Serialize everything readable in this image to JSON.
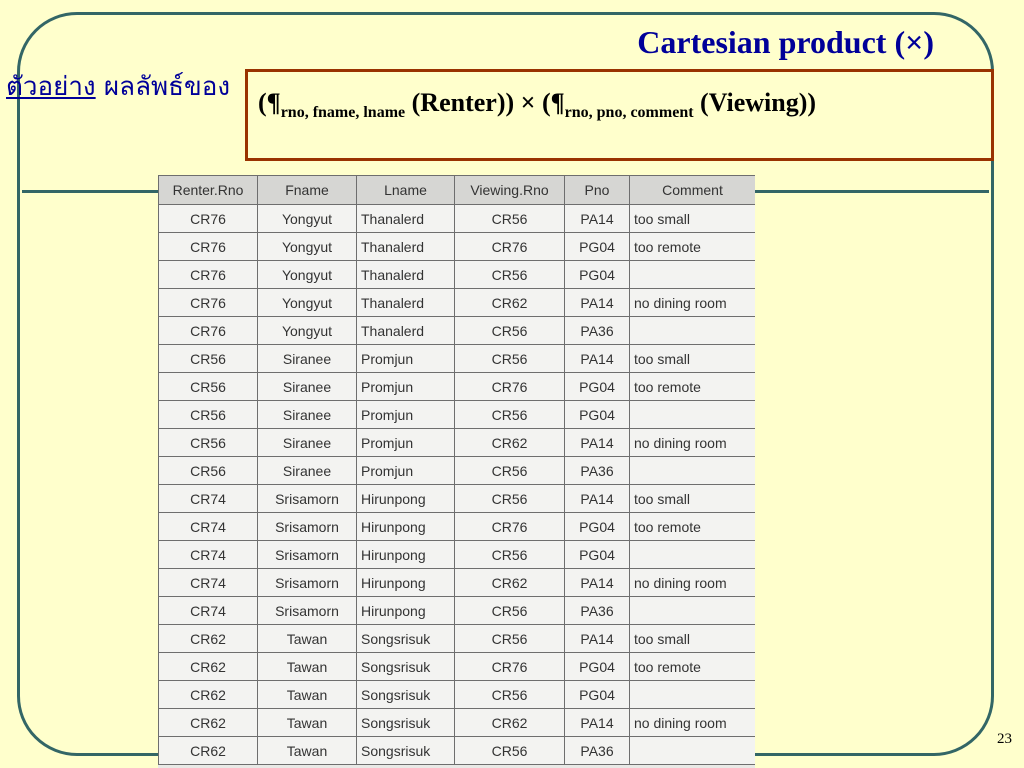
{
  "title": "Cartesian product (×)",
  "example": {
    "label": "ตัวอย่าง",
    "text": "ผลลัพธ์ของ"
  },
  "formula": {
    "open1": "(¶",
    "sub1": "rno, fname, lname",
    "rel1": " (Renter)) × (¶",
    "sub2": "rno, pno, comment",
    "rel2": " (Viewing))"
  },
  "table": {
    "headers": [
      "Renter.Rno",
      "Fname",
      "Lname",
      "Viewing.Rno",
      "Pno",
      "Comment"
    ],
    "rows": [
      [
        "CR76",
        "Yongyut",
        "Thanalerd",
        "CR56",
        "PA14",
        "too small"
      ],
      [
        "CR76",
        "Yongyut",
        "Thanalerd",
        "CR76",
        "PG04",
        "too remote"
      ],
      [
        "CR76",
        "Yongyut",
        "Thanalerd",
        "CR56",
        "PG04",
        ""
      ],
      [
        "CR76",
        "Yongyut",
        "Thanalerd",
        "CR62",
        "PA14",
        "no dining room"
      ],
      [
        "CR76",
        "Yongyut",
        "Thanalerd",
        "CR56",
        "PA36",
        ""
      ],
      [
        "CR56",
        "Siranee",
        "Promjun",
        "CR56",
        "PA14",
        "too small"
      ],
      [
        "CR56",
        "Siranee",
        "Promjun",
        "CR76",
        "PG04",
        "too remote"
      ],
      [
        "CR56",
        "Siranee",
        "Promjun",
        "CR56",
        "PG04",
        ""
      ],
      [
        "CR56",
        "Siranee",
        "Promjun",
        "CR62",
        "PA14",
        "no dining room"
      ],
      [
        "CR56",
        "Siranee",
        "Promjun",
        "CR56",
        "PA36",
        ""
      ],
      [
        "CR74",
        "Srisamorn",
        "Hirunpong",
        "CR56",
        "PA14",
        "too small"
      ],
      [
        "CR74",
        "Srisamorn",
        "Hirunpong",
        "CR76",
        "PG04",
        "too remote"
      ],
      [
        "CR74",
        "Srisamorn",
        "Hirunpong",
        "CR56",
        "PG04",
        ""
      ],
      [
        "CR74",
        "Srisamorn",
        "Hirunpong",
        "CR62",
        "PA14",
        "no dining room"
      ],
      [
        "CR74",
        "Srisamorn",
        "Hirunpong",
        "CR56",
        "PA36",
        ""
      ],
      [
        "CR62",
        "Tawan",
        "Songsrisuk",
        "CR56",
        "PA14",
        "too small"
      ],
      [
        "CR62",
        "Tawan",
        "Songsrisuk",
        "CR76",
        "PG04",
        "too remote"
      ],
      [
        "CR62",
        "Tawan",
        "Songsrisuk",
        "CR56",
        "PG04",
        ""
      ],
      [
        "CR62",
        "Tawan",
        "Songsrisuk",
        "CR62",
        "PA14",
        "no dining room"
      ],
      [
        "CR62",
        "Tawan",
        "Songsrisuk",
        "CR56",
        "PA36",
        ""
      ]
    ]
  },
  "page_number": "23"
}
